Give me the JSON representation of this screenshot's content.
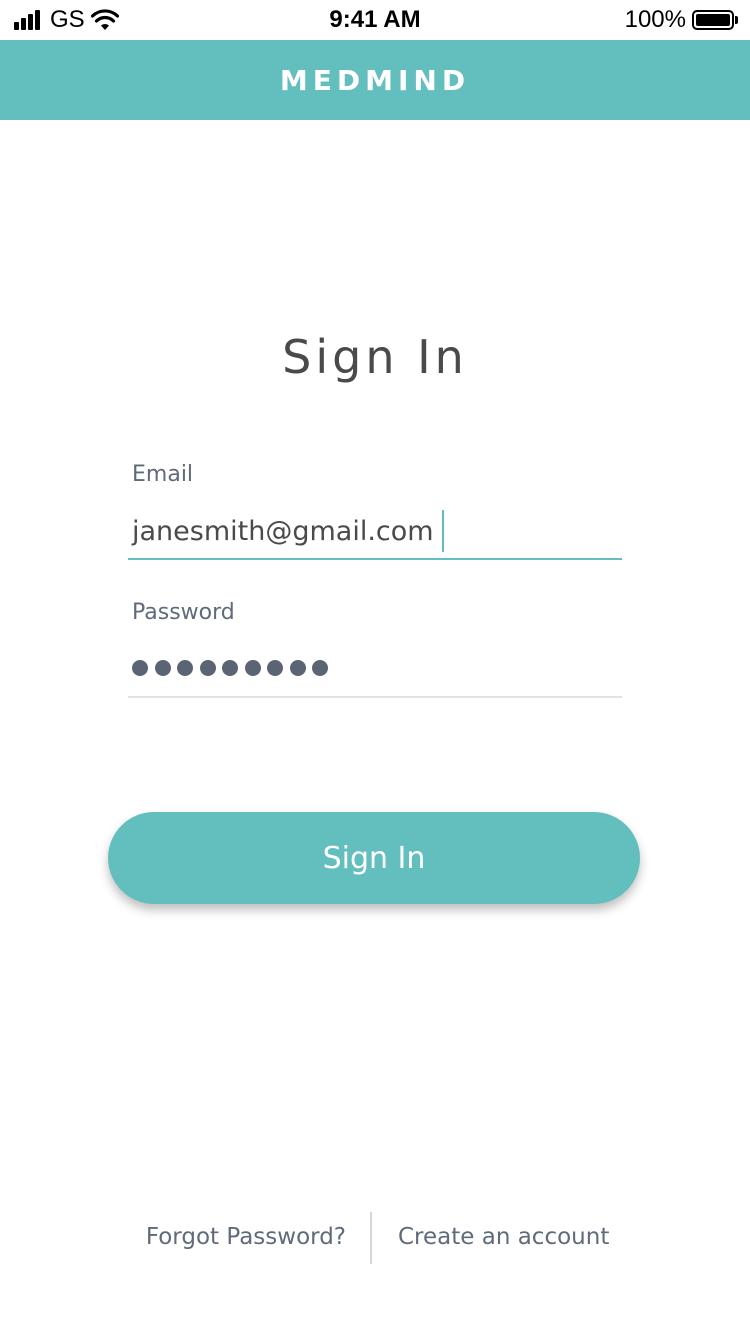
{
  "status_bar": {
    "carrier": "GS",
    "time": "9:41 AM",
    "battery_percent": "100%",
    "signal_strength": 4,
    "battery_level": 1.0,
    "icons": [
      "signal-bars-icon",
      "wifi-icon",
      "battery-icon"
    ]
  },
  "header": {
    "app_title": "MEDMIND",
    "background_color": "#63bfbe"
  },
  "sign_in": {
    "title": "Sign In",
    "email": {
      "label": "Email",
      "value": "janesmith@gmail.com",
      "focused": true
    },
    "password": {
      "label": "Password",
      "masked_length": 9
    },
    "submit_label": "Sign In"
  },
  "footer": {
    "forgot_password": "Forgot Password?",
    "create_account": "Create an account"
  },
  "colors": {
    "accent": "#63bfbe",
    "text_primary": "#4a4a4a",
    "text_secondary": "#5f6b7a",
    "divider": "#e2e2e2"
  }
}
